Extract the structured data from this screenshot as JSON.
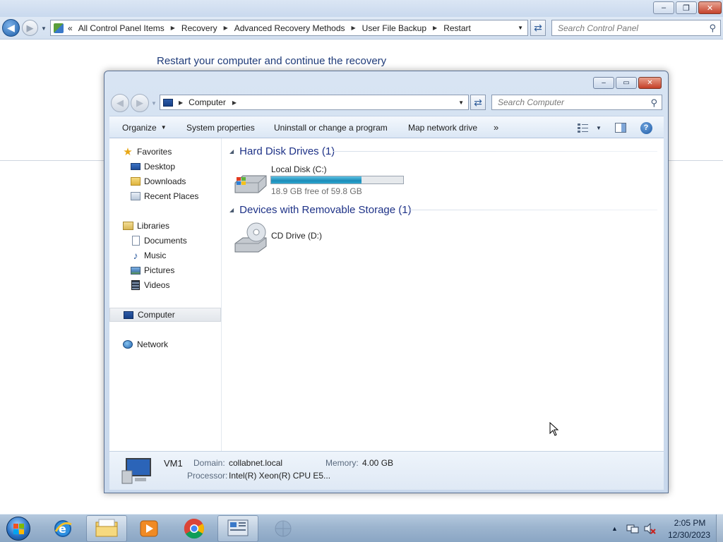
{
  "control_panel": {
    "caption_buttons": {
      "minimize": "–",
      "maximize": "❐",
      "close": "✕"
    },
    "breadcrumb": {
      "overflow": "«",
      "items": [
        "All Control Panel Items",
        "Recovery",
        "Advanced Recovery Methods",
        "User File Backup",
        "Restart"
      ]
    },
    "search_placeholder": "Search Control Panel",
    "heading": "Restart your computer and continue the recovery"
  },
  "explorer": {
    "caption_buttons": {
      "minimize": "–",
      "maximize": "▭",
      "close": "✕"
    },
    "breadcrumb": {
      "items": [
        "Computer"
      ]
    },
    "search_placeholder": "Search Computer",
    "toolbar": {
      "organize": "Organize",
      "system_properties": "System properties",
      "uninstall": "Uninstall or change a program",
      "map_network_drive": "Map network drive",
      "more": "»"
    },
    "nav": {
      "favorites": "Favorites",
      "desktop": "Desktop",
      "downloads": "Downloads",
      "recent_places": "Recent Places",
      "libraries": "Libraries",
      "documents": "Documents",
      "music": "Music",
      "pictures": "Pictures",
      "videos": "Videos",
      "computer": "Computer",
      "network": "Network"
    },
    "groups": {
      "hard_disk": "Hard Disk Drives (1)",
      "removable": "Devices with Removable Storage (1)"
    },
    "drives": {
      "local_disk": {
        "name": "Local Disk (C:)",
        "free_text": "18.9 GB free of 59.8 GB",
        "used_fraction": 0.684
      },
      "cd_drive": {
        "name": "CD Drive (D:)"
      }
    },
    "details": {
      "name": "VM1",
      "domain_label": "Domain:",
      "domain_value": "collabnet.local",
      "memory_label": "Memory:",
      "memory_value": "4.00 GB",
      "processor_label": "Processor:",
      "processor_value": "Intel(R) Xeon(R) CPU E5..."
    }
  },
  "taskbar": {
    "clock_time": "2:05 PM",
    "clock_date": "12/30/2023",
    "pinned": [
      "internet-explorer",
      "windows-explorer",
      "media-player",
      "chrome",
      "control-panel",
      "network-app"
    ]
  },
  "colors": {
    "accent_blue": "#1f3b79",
    "group_header": "#1e3287",
    "drive_bar_fill": "#1c8cb8"
  }
}
